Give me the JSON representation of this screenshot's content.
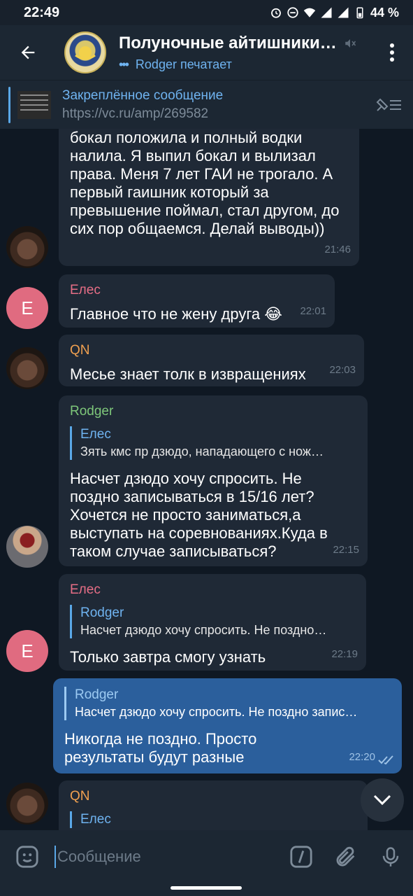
{
  "status_bar": {
    "time": "22:49",
    "battery": "44 %"
  },
  "header": {
    "title": "Полуночные айтишники…",
    "typing_user": "Rodger",
    "typing_text": "печатает"
  },
  "pinned": {
    "title": "Закреплённое сообщение",
    "url": "https://vc.ru/amp/269582"
  },
  "messages": [
    {
      "id": "m1",
      "sender": "",
      "text": "бокал положила и полный водки налила.  Я выпил бокал и вылизал права. Меня 7 лет ГАИ не трогало. А первый гаишник который за превышение поймал, стал другом, до сих пор общаемся. Делай выводы))",
      "time": "21:46"
    },
    {
      "id": "m2",
      "sender": "Елес",
      "text": "Главное что не жену друга 😂",
      "time": "22:01",
      "avatar_letter": "Е"
    },
    {
      "id": "m3",
      "sender": "QN",
      "text": "Месье знает толк в извращениях",
      "time": "22:03"
    },
    {
      "id": "m4",
      "sender": "Rodger",
      "reply_name": "Елес",
      "reply_text": "Зять кмс пр дзюдо,  нападающего с нож…",
      "text": "Насчет дзюдо хочу спросить. Не поздно записываться в 15/16 лет? Хочется не просто заниматься,а выступать на соревнованиях.Куда в таком случае записываться?",
      "time": "22:15"
    },
    {
      "id": "m5",
      "sender": "Елес",
      "reply_name": "Rodger",
      "reply_text": "Насчет дзюдо хочу спросить. Не поздно…",
      "text": "Только завтра смогу узнать",
      "time": "22:19",
      "avatar_letter": "Е"
    },
    {
      "id": "m6",
      "sender": "",
      "reply_name": "Rodger",
      "reply_text": "Насчет дзюдо хочу спросить. Не поздно запис…",
      "text": "Никогда не поздно. Просто результаты будут разные",
      "time": "22:20"
    },
    {
      "id": "m7",
      "sender": "QN",
      "reply_name": "Елес"
    }
  ],
  "input": {
    "placeholder": "Сообщение"
  },
  "colors": {
    "accent": "#6fb3f0",
    "sender_eles": "#e76e86",
    "sender_qn": "#f0a050",
    "sender_rodger": "#7ec77a",
    "outgoing_bubble": "#2b5f9c",
    "incoming_bubble": "#1f2936"
  }
}
